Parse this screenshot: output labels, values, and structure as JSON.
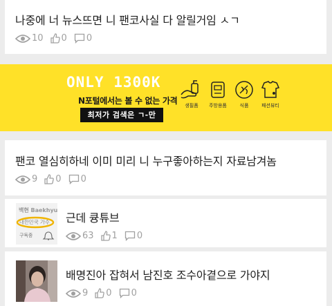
{
  "posts": [
    {
      "title": "나중에 너 뉴스뜨면 니 팬코사실 다 알릴거임 ㅅㄱ",
      "views": "10",
      "likes": "0",
      "comments": "0"
    },
    {
      "title": "팬코 열심히하네 이미 미리 니 누구좋아하는지 자료남겨놈",
      "views": "9",
      "likes": "0",
      "comments": "0"
    },
    {
      "title": "근데 큥튜브",
      "views": "63",
      "likes": "1",
      "comments": "0",
      "thumb": {
        "line1": "백현 Baekhyu",
        "line2": "내한민국 가수",
        "line3": "구독중"
      }
    },
    {
      "title": "배명진아 잡혀서 남진호 조수아곁으로 가야지",
      "views": "9",
      "likes": "0",
      "comments": "0"
    }
  ],
  "banner": {
    "headline": "ONLY 1300K",
    "subline": "N포털에서는 볼 수 없는 가격",
    "button": "최저가 검색은 ㄱ-만",
    "categories": [
      {
        "label": "생필품",
        "icon": "hand-soap-icon"
      },
      {
        "label": "주방용품",
        "icon": "rice-cooker-icon"
      },
      {
        "label": "식품",
        "icon": "food-icon"
      },
      {
        "label": "패션뷰티",
        "icon": "clothes-icon"
      }
    ],
    "color": "#ffe128"
  },
  "colors": {
    "meta": "#a0a0a0",
    "title": "#1f1f1f",
    "background": "#ececec"
  }
}
